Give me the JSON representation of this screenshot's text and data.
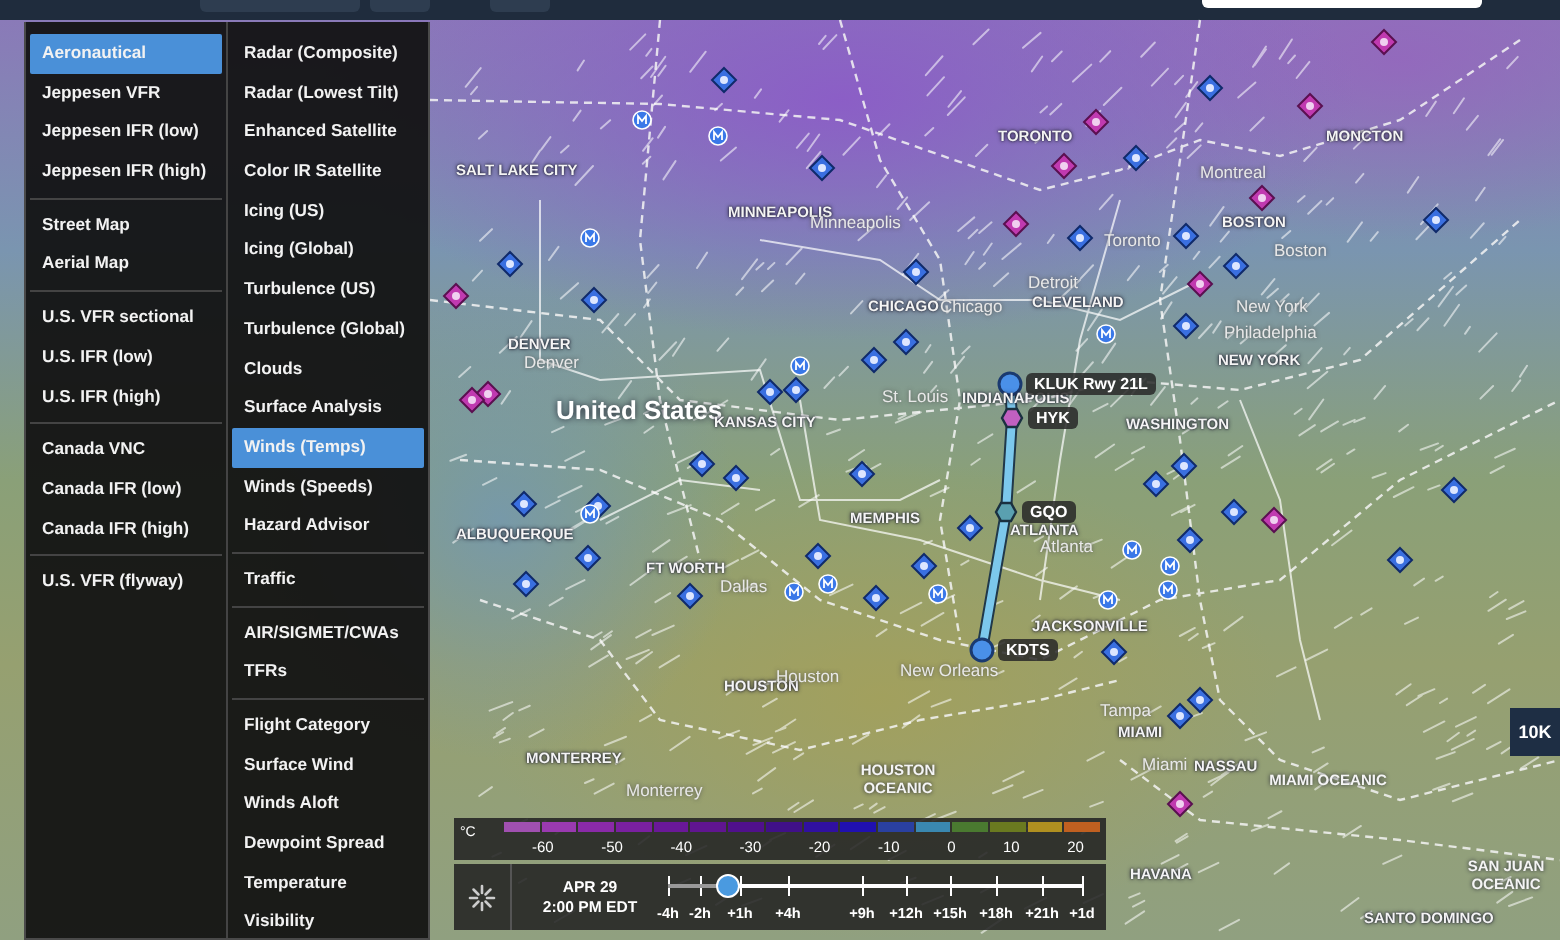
{
  "layer_menu": {
    "columns": [
      {
        "groups": [
          [
            {
              "label": "Aeronautical",
              "selected": true
            },
            {
              "label": "Jeppesen VFR",
              "selected": false
            },
            {
              "label": "Jeppesen IFR (low)",
              "selected": false
            },
            {
              "label": "Jeppesen IFR (high)",
              "selected": false
            }
          ],
          [
            {
              "label": "Street Map",
              "selected": false
            },
            {
              "label": "Aerial Map",
              "selected": false
            }
          ],
          [
            {
              "label": "U.S. VFR sectional",
              "selected": false
            },
            {
              "label": "U.S. IFR (low)",
              "selected": false
            },
            {
              "label": "U.S. IFR (high)",
              "selected": false
            }
          ],
          [
            {
              "label": "Canada VNC",
              "selected": false
            },
            {
              "label": "Canada IFR (low)",
              "selected": false
            },
            {
              "label": "Canada IFR (high)",
              "selected": false
            }
          ],
          [
            {
              "label": "U.S. VFR (flyway)",
              "selected": false
            }
          ]
        ]
      },
      {
        "groups": [
          [
            {
              "label": "Radar (Composite)",
              "selected": false
            },
            {
              "label": "Radar (Lowest Tilt)",
              "selected": false
            },
            {
              "label": "Enhanced Satellite",
              "selected": false
            },
            {
              "label": "Color IR Satellite",
              "selected": false
            },
            {
              "label": "Icing (US)",
              "selected": false
            },
            {
              "label": "Icing (Global)",
              "selected": false
            },
            {
              "label": "Turbulence (US)",
              "selected": false
            },
            {
              "label": "Turbulence (Global)",
              "selected": false
            },
            {
              "label": "Clouds",
              "selected": false
            },
            {
              "label": "Surface Analysis",
              "selected": false
            },
            {
              "label": "Winds (Temps)",
              "selected": true
            },
            {
              "label": "Winds (Speeds)",
              "selected": false
            },
            {
              "label": "Hazard Advisor",
              "selected": false
            }
          ],
          [
            {
              "label": "Traffic",
              "selected": false
            }
          ],
          [
            {
              "label": "AIR/SIGMET/CWAs",
              "selected": false
            },
            {
              "label": "TFRs",
              "selected": false
            }
          ],
          [
            {
              "label": "Flight Category",
              "selected": false
            },
            {
              "label": "Surface Wind",
              "selected": false
            },
            {
              "label": "Winds Aloft",
              "selected": false
            },
            {
              "label": "Dewpoint Spread",
              "selected": false
            },
            {
              "label": "Temperature",
              "selected": false
            },
            {
              "label": "Visibility",
              "selected": false
            }
          ]
        ]
      }
    ]
  },
  "map": {
    "labels": [
      {
        "text": "TORONTO",
        "kind": "region"
      },
      {
        "text": "MONCTON",
        "kind": "region"
      },
      {
        "text": "Montreal",
        "kind": "city"
      },
      {
        "text": "MINNEAPOLIS",
        "kind": "region"
      },
      {
        "text": "Minneapolis",
        "kind": "city"
      },
      {
        "text": "BOSTON",
        "kind": "region"
      },
      {
        "text": "Toronto",
        "kind": "city"
      },
      {
        "text": "Boston",
        "kind": "city"
      },
      {
        "text": "SALT LAKE CITY",
        "kind": "region"
      },
      {
        "text": "CHICAGO",
        "kind": "region"
      },
      {
        "text": "Chicago",
        "kind": "city"
      },
      {
        "text": "Detroit",
        "kind": "city"
      },
      {
        "text": "CLEVELAND",
        "kind": "region"
      },
      {
        "text": "New York",
        "kind": "city"
      },
      {
        "text": "Philadelphia",
        "kind": "city"
      },
      {
        "text": "NEW YORK",
        "kind": "region"
      },
      {
        "text": "DENVER",
        "kind": "region"
      },
      {
        "text": "Denver",
        "kind": "city"
      },
      {
        "text": "United States",
        "kind": "country"
      },
      {
        "text": "KANSAS CITY",
        "kind": "region"
      },
      {
        "text": "St. Louis",
        "kind": "city"
      },
      {
        "text": "INDIANAPOLIS",
        "kind": "region"
      },
      {
        "text": "WASHINGTON",
        "kind": "region"
      },
      {
        "text": "ALBUQUERQUE",
        "kind": "region"
      },
      {
        "text": "MEMPHIS",
        "kind": "region"
      },
      {
        "text": "ATLANTA",
        "kind": "region"
      },
      {
        "text": "Atlanta",
        "kind": "city"
      },
      {
        "text": "FT WORTH",
        "kind": "region"
      },
      {
        "text": "Dallas",
        "kind": "city"
      },
      {
        "text": "JACKSONVILLE",
        "kind": "region"
      },
      {
        "text": "HOUSTON",
        "kind": "region"
      },
      {
        "text": "Houston",
        "kind": "city"
      },
      {
        "text": "New Orleans",
        "kind": "city"
      },
      {
        "text": "Tampa",
        "kind": "city"
      },
      {
        "text": "MIAMI",
        "kind": "region"
      },
      {
        "text": "HOUSTON OCEANIC",
        "kind": "ocean"
      },
      {
        "text": "Miami",
        "kind": "city"
      },
      {
        "text": "NASSAU",
        "kind": "region"
      },
      {
        "text": "MIAMI OCEANIC",
        "kind": "ocean"
      },
      {
        "text": "MONTERREY",
        "kind": "region"
      },
      {
        "text": "Monterrey",
        "kind": "city"
      },
      {
        "text": "HAVANA",
        "kind": "region"
      },
      {
        "text": "SAN JUAN OCEANIC",
        "kind": "ocean"
      },
      {
        "text": "SANTO DOMINGO",
        "kind": "region"
      }
    ],
    "route": {
      "waypoints": [
        {
          "label": "KLUK Rwy 21L",
          "kind": "airport"
        },
        {
          "label": "HYK",
          "kind": "vor"
        },
        {
          "label": "GQO",
          "kind": "vor"
        },
        {
          "label": "KDTS",
          "kind": "airport"
        }
      ]
    }
  },
  "altitude_button": "10K",
  "temperature_legend": {
    "unit": "°C",
    "ticks": [
      "-60",
      "-50",
      "-40",
      "-30",
      "-20",
      "-10",
      "0",
      "10",
      "20"
    ]
  },
  "timeline": {
    "date": "APR 29",
    "time": "2:00 PM EDT",
    "ticks": [
      "-4h",
      "-2h",
      "+1h",
      "+4h",
      "+9h",
      "+12h",
      "+15h",
      "+18h",
      "+21h",
      "+1d"
    ],
    "level": 0.145
  }
}
